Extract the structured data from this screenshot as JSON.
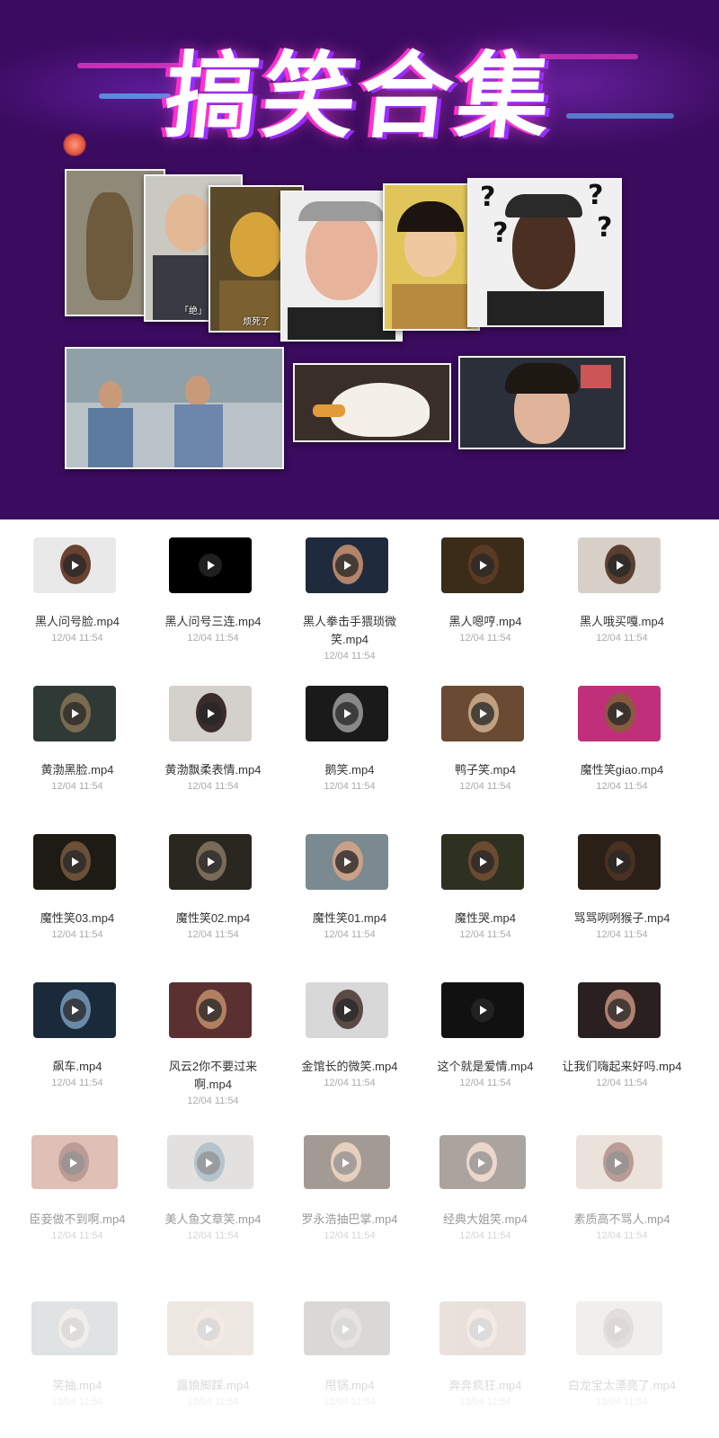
{
  "banner": {
    "title": "搞笑合集",
    "captions": {
      "jue": "「绝」",
      "fansile": "烦死了"
    },
    "question_mark": "?"
  },
  "colors": {
    "banner_bg": "#3a0b5e",
    "title_shadow_pink": "#ff2fd0",
    "title_shadow_purple": "#9a2cff",
    "file_name": "#333333",
    "file_date": "#aaaaaa"
  },
  "icons": {
    "play": "play-icon"
  },
  "files": [
    {
      "name": "黑人问号脸.mp4",
      "date": "12/04 11:54"
    },
    {
      "name": "黑人问号三连.mp4",
      "date": "12/04 11:54"
    },
    {
      "name": "黑人拳击手猥琐微笑.mp4",
      "date": "12/04 11:54"
    },
    {
      "name": "黑人嗯哼.mp4",
      "date": "12/04 11:54"
    },
    {
      "name": "黑人哦买嘎.mp4",
      "date": "12/04 11:54"
    },
    {
      "name": "黄渤黑脸.mp4",
      "date": "12/04 11:54"
    },
    {
      "name": "黄渤飘柔表情.mp4",
      "date": "12/04 11:54"
    },
    {
      "name": "鹅笑.mp4",
      "date": "12/04 11:54"
    },
    {
      "name": "鸭子笑.mp4",
      "date": "12/04 11:54"
    },
    {
      "name": "魔性笑giao.mp4",
      "date": "12/04 11:54"
    },
    {
      "name": "魔性笑03.mp4",
      "date": "12/04 11:54"
    },
    {
      "name": "魔性笑02.mp4",
      "date": "12/04 11:54"
    },
    {
      "name": "魔性笑01.mp4",
      "date": "12/04 11:54"
    },
    {
      "name": "魔性哭.mp4",
      "date": "12/04 11:54"
    },
    {
      "name": "骂骂咧咧猴子.mp4",
      "date": "12/04 11:54"
    },
    {
      "name": "飙车.mp4",
      "date": "12/04 11:54"
    },
    {
      "name": "风云2你不要过来啊.mp4",
      "date": "12/04 11:54"
    },
    {
      "name": "金馆长的微笑.mp4",
      "date": "12/04 11:54"
    },
    {
      "name": "这个就是爱情.mp4",
      "date": "12/04 11:54"
    },
    {
      "name": "让我们嗨起来好吗.mp4",
      "date": "12/04 11:54"
    },
    {
      "name": "臣妾做不到啊.mp4",
      "date": "12/04 11:54"
    },
    {
      "name": "美人鱼文章笑.mp4",
      "date": "12/04 11:54"
    },
    {
      "name": "罗永浩抽巴掌.mp4",
      "date": "12/04 11:54"
    },
    {
      "name": "经典大姐笑.mp4",
      "date": "12/04 11:54"
    },
    {
      "name": "素质高不骂人.mp4",
      "date": "12/04 11:54"
    },
    {
      "name": "笑抽.mp4",
      "date": "12/04 11:54"
    },
    {
      "name": "露娘脚踩.mp4",
      "date": "12/04 11:54"
    },
    {
      "name": "甩锅.mp4",
      "date": "12/04 11:54"
    },
    {
      "name": "奔奔疯狂.mp4",
      "date": "12/04 11:54"
    },
    {
      "name": "白龙宝太漂亮了.mp4",
      "date": "12/04 11:54"
    }
  ]
}
